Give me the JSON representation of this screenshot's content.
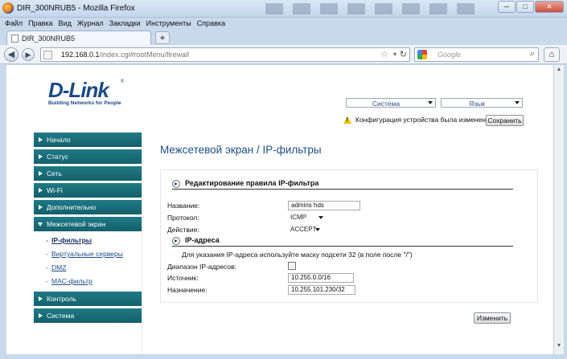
{
  "window": {
    "title": "DIR_300NRUB5 - Mozilla Firefox",
    "min": "─",
    "max": "□",
    "close": "✕"
  },
  "menu": [
    "Файл",
    "Правка",
    "Вид",
    "Журнал",
    "Закладки",
    "Инструменты",
    "Справка"
  ],
  "tab": {
    "label": "DIR_300NRUB5",
    "new": "+"
  },
  "nav": {
    "back": "◀",
    "forward": "▶",
    "url_host": "192.168.0.1",
    "url_path": "/index.cgi#rootMenu/firewall",
    "star": "☆",
    "drop": "▾",
    "reload": "↻",
    "search_placeholder": "Google",
    "search_icon": "⌕",
    "home": "⌂"
  },
  "brand": {
    "name": "D-Link",
    "reg": "®",
    "tagline": "Building Networks for People"
  },
  "top": {
    "system_select": "Система",
    "language_select": "Язык",
    "warning_glyph": "!",
    "warning": "Конфигурация устройства была изменена",
    "save": "Сохранить"
  },
  "sidebar": {
    "items": [
      {
        "label": "Начало"
      },
      {
        "label": "Статус"
      },
      {
        "label": "Сеть"
      },
      {
        "label": "Wi-Fi"
      },
      {
        "label": "Дополнительно"
      },
      {
        "label": "Межсетевой экран"
      }
    ],
    "subitems": [
      {
        "label": "IP-фильтры",
        "active": true
      },
      {
        "label": "Виртуальные серверы"
      },
      {
        "label": "DMZ"
      },
      {
        "label": "MAC-фильтр"
      }
    ],
    "bottom_items": [
      {
        "label": "Контроль"
      },
      {
        "label": "Система"
      }
    ],
    "bullet": "-"
  },
  "main": {
    "title": "Межсетевой экран  /  IP-фильтры",
    "section1": "Редактирование правила IP-фильтра",
    "name_label": "Название:",
    "name_value": "admins hds",
    "protocol_label": "Протокол:",
    "protocol_value": "ICMP",
    "action_label": "Действие:",
    "action_value": "ACCEPT",
    "section2": "IP-адреса",
    "hint": "Для указания IP-адреса используйте маску подсети 32 (в поле после \"/\")",
    "range_label": "Диапазон IP-адресов:",
    "range_checked": false,
    "source_label": "Источник:",
    "source_value": "10.255.0.0/16",
    "dest_label": "Назначение:",
    "dest_value": "10.255.101.230/32",
    "change_button": "Изменить"
  },
  "scrollbar": {
    "up": "▲",
    "down": "▼"
  }
}
